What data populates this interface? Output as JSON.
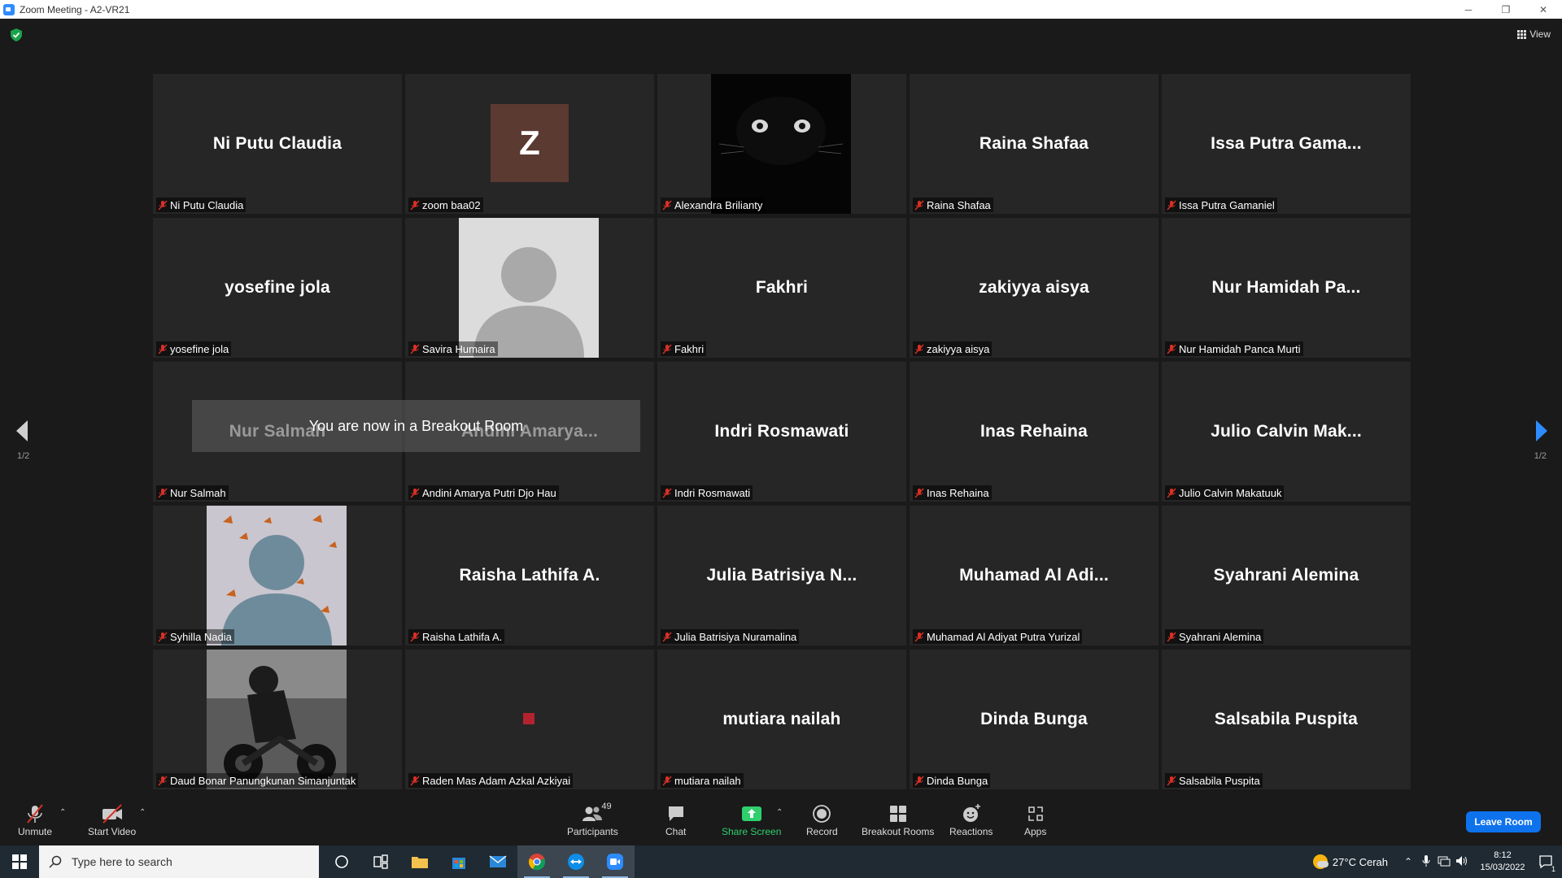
{
  "window": {
    "title": "Zoom Meeting - A2-VR21",
    "minimize": "─",
    "maximize": "❐",
    "close": "✕"
  },
  "view_label": "View",
  "banner": "You are now in a Breakout Room",
  "pagination": {
    "left": "1/2",
    "right": "1/2"
  },
  "tiles": [
    {
      "bigname": "Ni Putu Claudia",
      "label": "Ni Putu Claudia"
    },
    {
      "bigname": "",
      "avatar_letter": "Z",
      "label": "zoom baa02"
    },
    {
      "bigname": "",
      "label": "Alexandra Brilianty"
    },
    {
      "bigname": "Raina Shafaa",
      "label": "Raina Shafaa"
    },
    {
      "bigname": "Issa Putra Gama...",
      "label": "Issa Putra Gamaniel"
    },
    {
      "bigname": "yosefine jola",
      "label": "yosefine jola"
    },
    {
      "bigname": "",
      "label": "Savira Humaira"
    },
    {
      "bigname": "Fakhri",
      "label": "Fakhri"
    },
    {
      "bigname": "zakiyya aisya",
      "label": "zakiyya aisya"
    },
    {
      "bigname": "Nur Hamidah Pa...",
      "label": "Nur Hamidah Panca Murti"
    },
    {
      "bigname": "Nur Salmah",
      "label": "Nur Salmah"
    },
    {
      "bigname": "Andini Amarya...",
      "label": "Andini Amarya Putri Djo Hau"
    },
    {
      "bigname": "Indri Rosmawati",
      "label": "Indri Rosmawati"
    },
    {
      "bigname": "Inas Rehaina",
      "label": "Inas Rehaina"
    },
    {
      "bigname": "Julio Calvin Mak...",
      "label": "Julio Calvin Makatuuk"
    },
    {
      "bigname": "",
      "label": "Syhilla Nadia"
    },
    {
      "bigname": "Raisha Lathifa A.",
      "label": "Raisha Lathifa A."
    },
    {
      "bigname": "Julia Batrisiya N...",
      "label": "Julia Batrisiya Nuramalina"
    },
    {
      "bigname": "Muhamad Al Adi...",
      "label": "Muhamad Al Adiyat Putra Yurizal"
    },
    {
      "bigname": "Syahrani Alemina",
      "label": "Syahrani Alemina"
    },
    {
      "bigname": "",
      "label": "Daud Bonar Panungkunan Simanjuntak"
    },
    {
      "bigname": "",
      "label": "Raden Mas Adam Azkal Azkiyai"
    },
    {
      "bigname": "mutiara nailah",
      "label": "mutiara nailah"
    },
    {
      "bigname": "Dinda Bunga",
      "label": "Dinda Bunga"
    },
    {
      "bigname": "Salsabila Puspita",
      "label": "Salsabila Puspita"
    }
  ],
  "toolbar": {
    "unmute": "Unmute",
    "start_video": "Start Video",
    "participants": "Participants",
    "participants_count": "49",
    "chat": "Chat",
    "share_screen": "Share Screen",
    "record": "Record",
    "breakout_rooms": "Breakout Rooms",
    "reactions": "Reactions",
    "apps": "Apps",
    "leave_room": "Leave Room"
  },
  "taskbar": {
    "search_placeholder": "Type here to search",
    "weather": "27°C  Cerah",
    "time": "8:12",
    "date": "15/03/2022",
    "notification_count": "1"
  },
  "colors": {
    "accent_blue": "#0e72ed",
    "share_green": "#2fcf6e",
    "muted_red": "#d93025"
  }
}
